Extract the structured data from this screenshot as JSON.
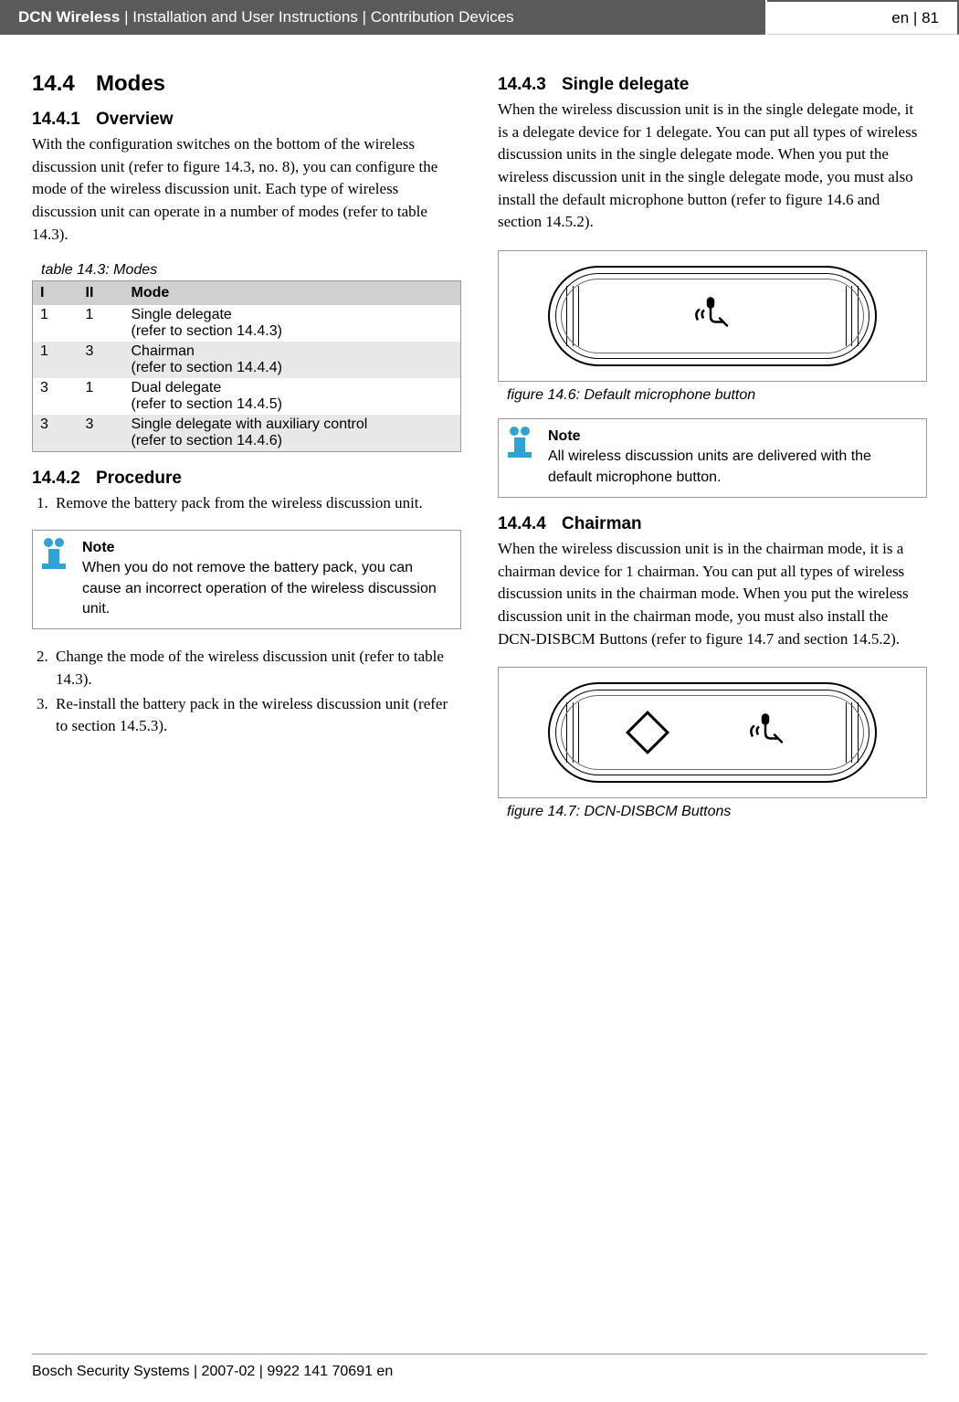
{
  "header": {
    "product": "DCN Wireless",
    "trail": "Installation and User Instructions",
    "section": "Contribution Devices",
    "lang": "en",
    "page": "81"
  },
  "s14_4": {
    "num": "14.4",
    "title": "Modes"
  },
  "s14_4_1": {
    "num": "14.4.1",
    "title": "Overview",
    "body": "With the configuration switches on the bottom of the wireless discussion unit (refer to figure 14.3, no. 8), you can configure the mode of the wireless discussion unit. Each type of wireless discussion unit can operate in a number of modes (refer to table 14.3)."
  },
  "table14_3": {
    "caption": "table 14.3: Modes",
    "head": {
      "c1": "I",
      "c2": "II",
      "c3": "Mode"
    },
    "rows": [
      {
        "c1": "1",
        "c2": "1",
        "mode": "Single delegate",
        "ref": "(refer to section 14.4.3)"
      },
      {
        "c1": "1",
        "c2": "3",
        "mode": "Chairman",
        "ref": "(refer to section 14.4.4)"
      },
      {
        "c1": "3",
        "c2": "1",
        "mode": "Dual delegate",
        "ref": "(refer to section 14.4.5)"
      },
      {
        "c1": "3",
        "c2": "3",
        "mode": "Single delegate with auxiliary control",
        "ref": "(refer to section 14.4.6)"
      }
    ]
  },
  "s14_4_2": {
    "num": "14.4.2",
    "title": "Procedure",
    "steps": {
      "s1": "Remove the battery pack from the wireless discussion unit.",
      "s2": "Change the mode of the wireless discussion unit (refer to table 14.3).",
      "s3": "Re-install the battery pack in the wireless discussion unit (refer to section 14.5.3)."
    }
  },
  "note1": {
    "title": "Note",
    "body": "When you do not remove the battery pack, you can cause an incorrect operation of the wireless discussion unit."
  },
  "s14_4_3": {
    "num": "14.4.3",
    "title": "Single delegate",
    "body": "When the wireless discussion unit is in the single delegate mode, it is a delegate device for 1 delegate. You can put all types of wireless discussion units in the single delegate mode. When you put the wireless discussion unit in the single delegate mode, you must also install the default microphone button (refer to figure 14.6 and section 14.5.2)."
  },
  "fig14_6": {
    "caption": "figure 14.6: Default microphone button"
  },
  "note2": {
    "title": "Note",
    "body": "All wireless discussion units are delivered with the default microphone button."
  },
  "s14_4_4": {
    "num": "14.4.4",
    "title": "Chairman",
    "body": "When the wireless discussion unit is in the chairman mode, it is a chairman device for 1 chairman. You can put all types of wireless discussion units in the chairman mode. When you put the wireless discussion unit in the chairman mode, you must also install the DCN-DISBCM Buttons (refer to figure 14.7 and section 14.5.2)."
  },
  "fig14_7": {
    "caption": "figure 14.7: DCN-DISBCM Buttons"
  },
  "footer": "Bosch Security Systems | 2007-02 | 9922 141 70691 en"
}
